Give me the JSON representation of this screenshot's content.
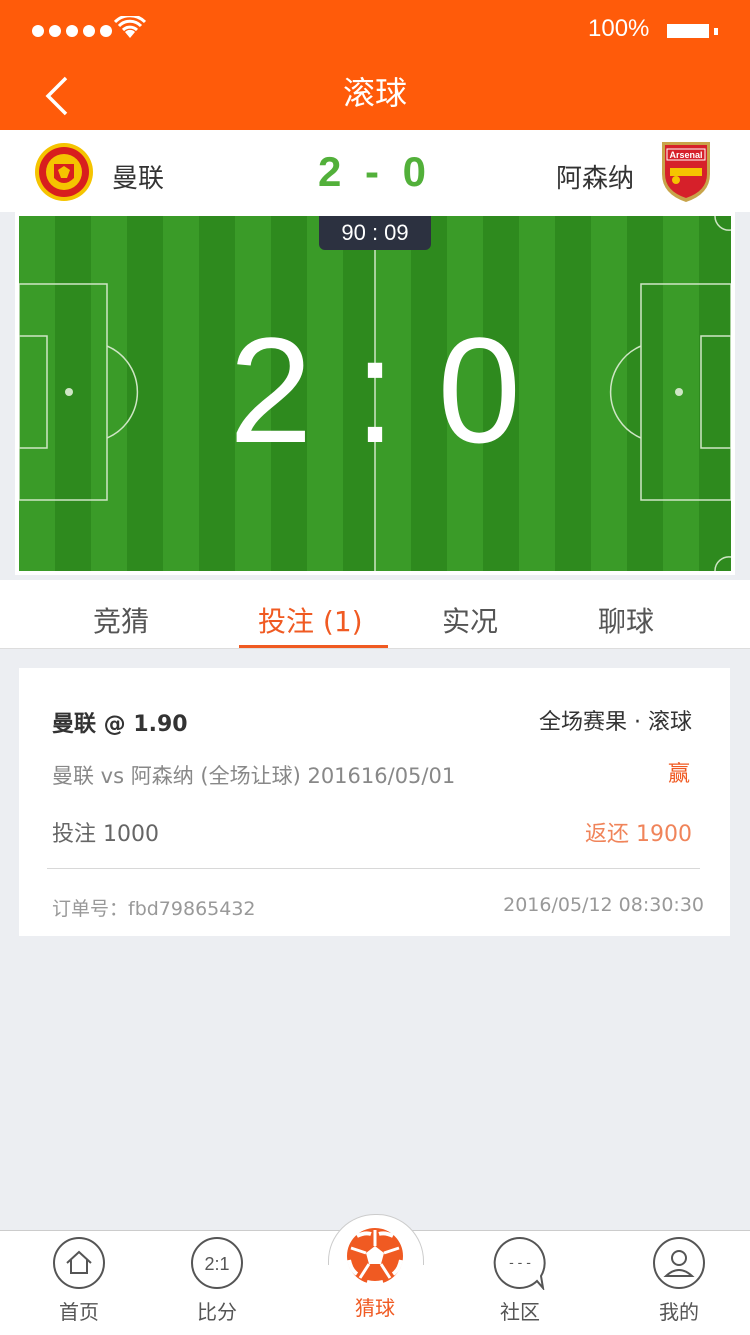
{
  "status_bar": {
    "battery": "100%"
  },
  "header": {
    "title": "滚球"
  },
  "match": {
    "home_team": "曼联",
    "away_team": "阿森纳",
    "score_mini": "2 - 0",
    "timer": "90 : 09",
    "big_score": "2 : 0"
  },
  "tabs": [
    {
      "label": "竞猜"
    },
    {
      "label": "投注 (1)"
    },
    {
      "label": "实况"
    },
    {
      "label": "聊球"
    }
  ],
  "bet": {
    "pick": "曼联 @ 1.90",
    "market": "全场赛果 · 滚球",
    "description": "曼联 vs 阿森纳 (全场让球) 201616/05/01",
    "result": "赢",
    "stake": "投注 1000",
    "returned": "返还 1900",
    "order_no": "订单号：fbd79865432",
    "time": "2016/05/12 08:30:30"
  },
  "nav": [
    {
      "label": "首页",
      "icon": "home-icon"
    },
    {
      "label": "比分",
      "icon": "score-icon",
      "icon_text": "2:1"
    },
    {
      "label": "猜球",
      "icon": "soccer-ball-icon"
    },
    {
      "label": "社区",
      "icon": "chat-icon",
      "icon_text": "- - -"
    },
    {
      "label": "我的",
      "icon": "profile-icon"
    }
  ],
  "colors": {
    "brand": "#ff5b0a",
    "accent": "#f05a22",
    "score_green": "#52b03a",
    "pitch_dark": "#2e8a1e",
    "pitch_light": "#3a9b28"
  }
}
